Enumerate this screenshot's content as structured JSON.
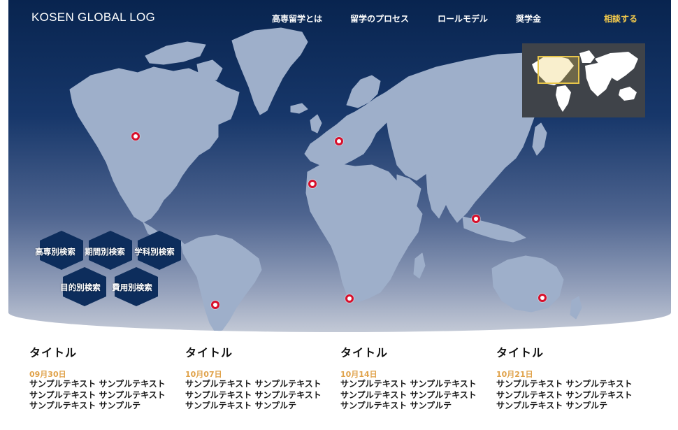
{
  "site": {
    "logo": "KOSEN GLOBAL LOG"
  },
  "nav": {
    "items": [
      {
        "label": "高専留学とは"
      },
      {
        "label": "留学のプロセス"
      },
      {
        "label": "ロールモデル"
      },
      {
        "label": "奨学金"
      },
      {
        "label": "相談する"
      }
    ],
    "accent_color": "#f2c94c"
  },
  "map": {
    "pin_color": "#d80f2b",
    "minimap_highlight_color": "#e8c64a"
  },
  "search": {
    "buttons": [
      {
        "label": "高専別検索"
      },
      {
        "label": "期間別検索"
      },
      {
        "label": "学科別検索"
      },
      {
        "label": "目的別検索"
      },
      {
        "label": "費用別検索"
      }
    ],
    "hex_color": "#0d2d5c"
  },
  "articles": [
    {
      "title": "タイトル",
      "date": "09月30日",
      "text": "サンプルテキスト サンプルテキスト サンプルテキスト サンプルテキスト サンプルテキスト サンプルテ"
    },
    {
      "title": "タイトル",
      "date": "10月07日",
      "text": "サンプルテキスト サンプルテキスト サンプルテキスト サンプルテキスト サンプルテキスト サンプルテ"
    },
    {
      "title": "タイトル",
      "date": "10月14日",
      "text": "サンプルテキスト サンプルテキスト サンプルテキスト サンプルテキスト サンプルテキスト サンプルテ"
    },
    {
      "title": "タイトル",
      "date": "10月21日",
      "text": "サンプルテキスト サンプルテキスト サンプルテキスト サンプルテキスト サンプルテキスト サンプルテ"
    }
  ],
  "colors": {
    "date": "#e0a24a",
    "hero_top": "#08244f",
    "land": "#9eafca"
  }
}
